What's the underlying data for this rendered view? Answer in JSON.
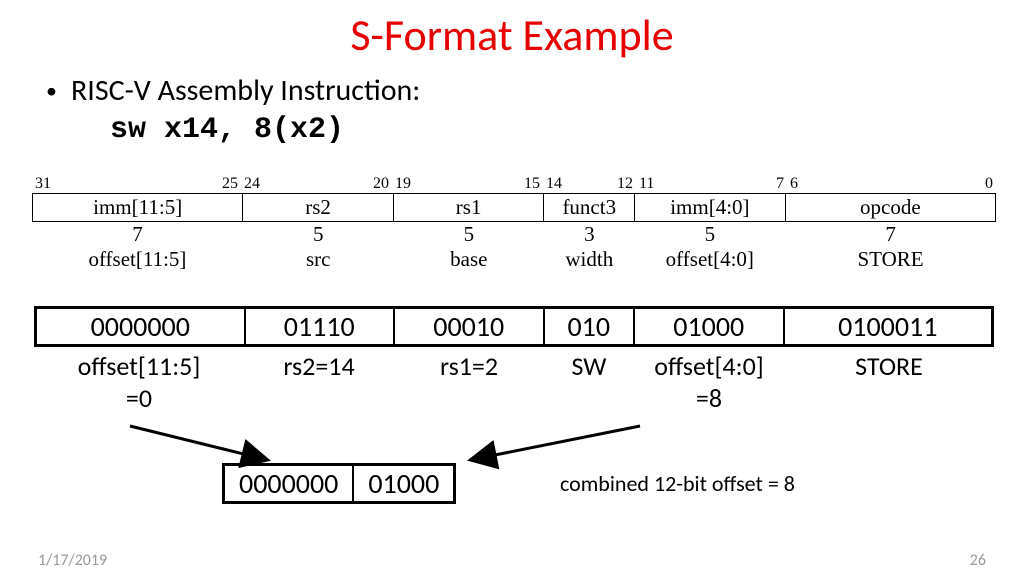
{
  "title": "S-Format Example",
  "bullet": "RISC-V Assembly Instruction:",
  "code": "sw x14, 8(x2)",
  "bits": {
    "b31": "31",
    "b25": "25",
    "b24": "24",
    "b20": "20",
    "b19": "19",
    "b15": "15",
    "b14": "14",
    "b12": "12",
    "b11": "11",
    "b7": "7",
    "b6": "6",
    "b0": "0"
  },
  "fields": {
    "f0": "imm[11:5]",
    "f1": "rs2",
    "f2": "rs1",
    "f3": "funct3",
    "f4": "imm[4:0]",
    "f5": "opcode"
  },
  "widths": {
    "w0": "7",
    "w1": "5",
    "w2": "5",
    "w3": "3",
    "w4": "5",
    "w5": "7"
  },
  "desc": {
    "d0": "offset[11:5]",
    "d1": "src",
    "d2": "base",
    "d3": "width",
    "d4": "offset[4:0]",
    "d5": "STORE"
  },
  "bin": {
    "b0": "0000000",
    "b1": "01110",
    "b2": "00010",
    "b3": "010",
    "b4": "01000",
    "b5": "0100011"
  },
  "ann": {
    "a0_l1": "offset[11:5]",
    "a0_l2": "=0",
    "a1": "rs2=14",
    "a2": "rs1=2",
    "a3": "SW",
    "a4_l1": "offset[4:0]",
    "a4_l2": "=8",
    "a5": "STORE"
  },
  "combined": {
    "c0": "0000000",
    "c1": "01000",
    "label": "combined 12-bit offset = 8"
  },
  "footer": {
    "date": "1/17/2019",
    "page": "26"
  }
}
